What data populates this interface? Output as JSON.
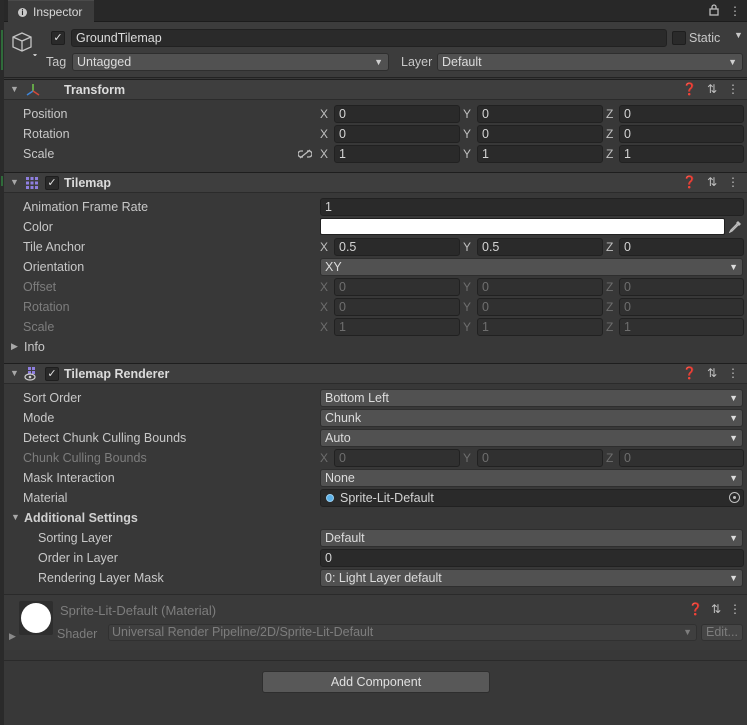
{
  "tab": {
    "title": "Inspector"
  },
  "header": {
    "name": "GroundTilemap",
    "static_label": "Static",
    "tag_label": "Tag",
    "tag_value": "Untagged",
    "layer_label": "Layer",
    "layer_value": "Default"
  },
  "transform": {
    "title": "Transform",
    "rows": [
      {
        "label": "Position",
        "x": "0",
        "y": "0",
        "z": "0"
      },
      {
        "label": "Rotation",
        "x": "0",
        "y": "0",
        "z": "0"
      },
      {
        "label": "Scale",
        "x": "1",
        "y": "1",
        "z": "1"
      }
    ]
  },
  "tilemap": {
    "title": "Tilemap",
    "animation_frame_rate_label": "Animation Frame Rate",
    "animation_frame_rate": "1",
    "color_label": "Color",
    "color_value": "#ffffff",
    "tile_anchor_label": "Tile Anchor",
    "tile_anchor": {
      "x": "0.5",
      "y": "0.5",
      "z": "0"
    },
    "orientation_label": "Orientation",
    "orientation_value": "XY",
    "offset_label": "Offset",
    "offset": {
      "x": "0",
      "y": "0",
      "z": "0"
    },
    "rotation_label": "Rotation",
    "rotation": {
      "x": "0",
      "y": "0",
      "z": "0"
    },
    "scale_label": "Scale",
    "scale": {
      "x": "1",
      "y": "1",
      "z": "1"
    },
    "info_label": "Info"
  },
  "renderer": {
    "title": "Tilemap Renderer",
    "sort_order_label": "Sort Order",
    "sort_order": "Bottom Left",
    "mode_label": "Mode",
    "mode": "Chunk",
    "detect_bounds_label": "Detect Chunk Culling Bounds",
    "detect_bounds": "Auto",
    "chunk_bounds_label": "Chunk Culling Bounds",
    "chunk_bounds": {
      "x": "0",
      "y": "0",
      "z": "0"
    },
    "mask_label": "Mask Interaction",
    "mask": "None",
    "material_label": "Material",
    "material": "Sprite-Lit-Default",
    "additional_label": "Additional Settings",
    "sorting_layer_label": "Sorting Layer",
    "sorting_layer": "Default",
    "order_label": "Order in Layer",
    "order": "0",
    "rendering_mask_label": "Rendering Layer Mask",
    "rendering_mask": "0: Light Layer default"
  },
  "material_panel": {
    "title": "Sprite-Lit-Default (Material)",
    "shader_label": "Shader",
    "shader": "Universal Render Pipeline/2D/Sprite-Lit-Default",
    "edit_label": "Edit..."
  },
  "axes": {
    "x": "X",
    "y": "Y",
    "z": "Z"
  },
  "add_component": "Add Component"
}
